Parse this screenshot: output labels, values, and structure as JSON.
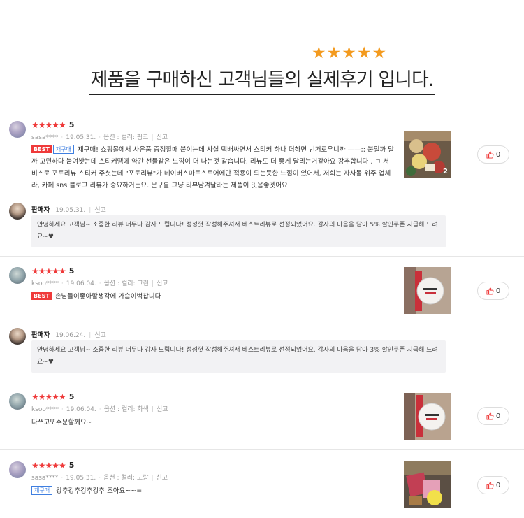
{
  "header": {
    "stars": "★★★★★",
    "title": "제품을 구매하신 고객님들의 실제후기 입니다."
  },
  "reviews": [
    {
      "stars": "★★★★★",
      "score": "5",
      "user": "sasa****",
      "date": "19.05.31.",
      "option": "옵션 : 컬러: 핑크",
      "report": "신고",
      "badges": {
        "best": "BEST",
        "repeat": "재구매"
      },
      "text": "재구매! 쇼핑몰에서 사은품 증정할때 붙이는데 사실 택배싸면서 스티커 하나 더하면 번거로우니까 ——;; 붙일까 말까 고민하다 붙여봣는데 스티커땜에 약간 선물같은 느낌이 더 나는것 같습니다. 리뷰도 더 좋게 달리는거같아요 강추합니다 . ㅋ 서비스로 포토리뷰 스티커 주셧는데 \"포토리뷰\"가 네이버스마트스토어에만 적용이 되는듯한 느낌이 있어서, 저희는 자사몰 위주 업체라, 카페 sns 블로그 리뷰가 중요하거든요. 문구를 그냥 리뷰남겨달라는 제품이 잇음좋겟어요",
      "photo_count": "2",
      "likes": "0",
      "seller": {
        "name": "판매자",
        "date": "19.05.31.",
        "report": "신고",
        "reply": "안녕하세요 고객님~ 소중한 리뷰 너무나 감사 드립니다! 정성껏 작성해주셔서 베스트리뷰로 선정되었어요. 감사의 마음을 담아 5% 할인쿠폰 지급해 드려요~♥"
      }
    },
    {
      "stars": "★★★★★",
      "score": "5",
      "user": "ksoo****",
      "date": "19.06.04.",
      "option": "옵션 : 컬러: 그린",
      "report": "신고",
      "badges": {
        "best": "BEST"
      },
      "text": "손님들이좋아할생각에 가슴이벅찹니다",
      "likes": "0",
      "seller": {
        "name": "판매자",
        "date": "19.06.24.",
        "report": "신고",
        "reply": "안녕하세요 고객님~ 소중한 리뷰 너무나 감사 드립니다! 정성껏 작성해주셔서 베스트리뷰로 선정되었어요. 감사의 마음을 담아 3% 할인쿠폰 지급해 드려요~♥"
      }
    },
    {
      "stars": "★★★★★",
      "score": "5",
      "user": "ksoo****",
      "date": "19.06.04.",
      "option": "옵션 : 컬러: 화색",
      "report": "신고",
      "text": "다쓰고또주문할께요~",
      "likes": "0"
    },
    {
      "stars": "★★★★★",
      "score": "5",
      "user": "sasa****",
      "date": "19.05.31.",
      "option": "옵션 : 컬러: 노랑",
      "report": "신고",
      "badges": {
        "repeat": "재구매"
      },
      "text": "강추강추강추강추 조아요~~=",
      "likes": "0"
    }
  ],
  "colors": {
    "star_orange": "#f39a1e",
    "star_red": "#ef3a3a",
    "best_badge": "#ef3a3a",
    "repeat_badge": "#3f7fe0"
  },
  "icons": {
    "like": "thumbs-up-icon"
  }
}
